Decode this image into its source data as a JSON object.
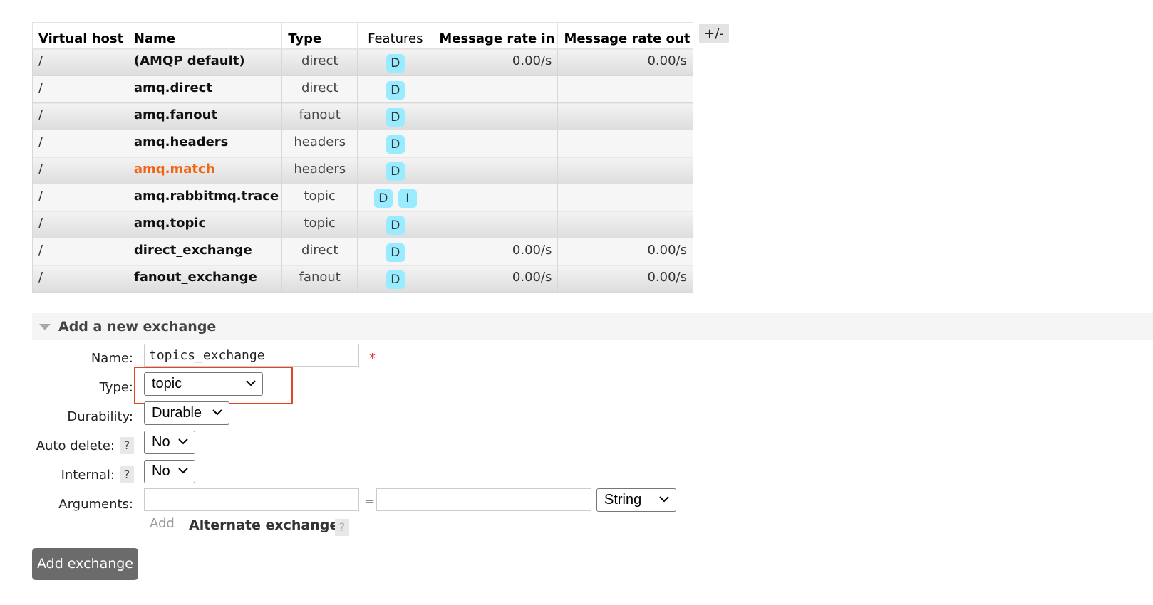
{
  "table": {
    "headers": {
      "virtual_host": "Virtual host",
      "name": "Name",
      "type": "Type",
      "features": "Features",
      "rate_in": "Message rate in",
      "rate_out": "Message rate out"
    },
    "columns_toggle": "+/-",
    "rows": [
      {
        "vhost": "/",
        "name": "(AMQP default)",
        "type": "direct",
        "features": [
          "D"
        ],
        "rate_in": "0.00/s",
        "rate_out": "0.00/s",
        "highlight": false
      },
      {
        "vhost": "/",
        "name": "amq.direct",
        "type": "direct",
        "features": [
          "D"
        ],
        "rate_in": "",
        "rate_out": "",
        "highlight": false
      },
      {
        "vhost": "/",
        "name": "amq.fanout",
        "type": "fanout",
        "features": [
          "D"
        ],
        "rate_in": "",
        "rate_out": "",
        "highlight": false
      },
      {
        "vhost": "/",
        "name": "amq.headers",
        "type": "headers",
        "features": [
          "D"
        ],
        "rate_in": "",
        "rate_out": "",
        "highlight": false
      },
      {
        "vhost": "/",
        "name": "amq.match",
        "type": "headers",
        "features": [
          "D"
        ],
        "rate_in": "",
        "rate_out": "",
        "highlight": true
      },
      {
        "vhost": "/",
        "name": "amq.rabbitmq.trace",
        "type": "topic",
        "features": [
          "D",
          "I"
        ],
        "rate_in": "",
        "rate_out": "",
        "highlight": false
      },
      {
        "vhost": "/",
        "name": "amq.topic",
        "type": "topic",
        "features": [
          "D"
        ],
        "rate_in": "",
        "rate_out": "",
        "highlight": false
      },
      {
        "vhost": "/",
        "name": "direct_exchange",
        "type": "direct",
        "features": [
          "D"
        ],
        "rate_in": "0.00/s",
        "rate_out": "0.00/s",
        "highlight": false
      },
      {
        "vhost": "/",
        "name": "fanout_exchange",
        "type": "fanout",
        "features": [
          "D"
        ],
        "rate_in": "0.00/s",
        "rate_out": "0.00/s",
        "highlight": false
      }
    ]
  },
  "add_section": {
    "title": "Add a new exchange",
    "labels": {
      "name": "Name:",
      "type": "Type:",
      "durability": "Durability:",
      "auto_delete": "Auto delete:",
      "internal": "Internal:",
      "arguments": "Arguments:"
    },
    "name_value": "topics_exchange",
    "required_mark": "*",
    "type_value": "topic",
    "durability_value": "Durable",
    "auto_delete_value": "No",
    "internal_value": "No",
    "help": "?",
    "arg_key": "",
    "arg_equals": "=",
    "arg_value": "",
    "arg_type": "String",
    "add_link": "Add",
    "alternate_exchange": "Alternate exchange",
    "submit": "Add exchange"
  },
  "colors": {
    "badge": "#99ebff",
    "highlight_name": "#f06412",
    "annotation_box": "#e34423",
    "button_bg": "#6b6b6b"
  }
}
